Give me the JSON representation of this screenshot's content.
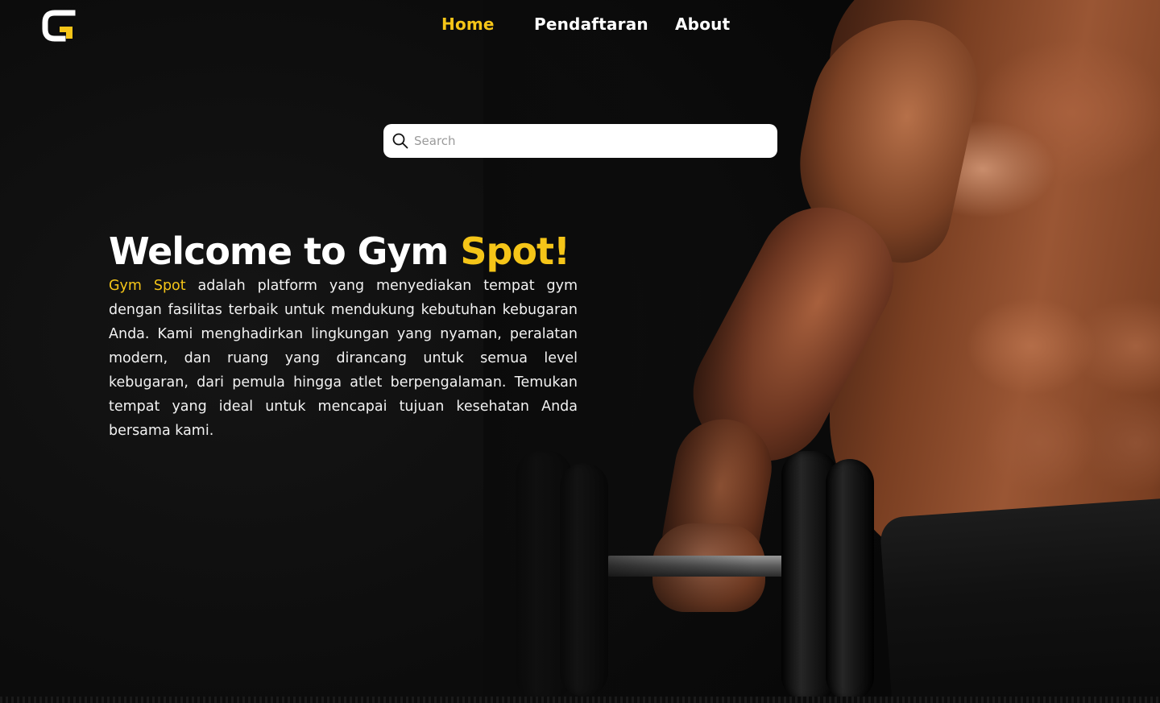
{
  "brand": {
    "logo_icon": "gym-spot-g-logo",
    "logo_colors": {
      "primary": "#ffffff",
      "accent": "#f5c518"
    }
  },
  "nav": {
    "items": [
      {
        "label": "Home",
        "active": true
      },
      {
        "label": "Pendaftaran",
        "active": false
      },
      {
        "label": "About",
        "active": false
      }
    ]
  },
  "search": {
    "icon": "search-icon",
    "placeholder": "Search",
    "value": ""
  },
  "hero": {
    "title_prefix": "Welcome to Gym ",
    "title_accent": "Spot!",
    "description_accent": "Gym Spot",
    "description_rest": " adalah platform yang menyediakan tempat gym dengan fasilitas terbaik untuk mendukung kebutuhan kebugaran Anda. Kami menghadirkan lingkungan yang nyaman, peralatan modern, dan ruang yang dirancang untuk semua level kebugaran, dari pemula hingga atlet berpengalaman. Temukan tempat yang ideal untuk mencapai tujuan kesehatan Anda bersama kami."
  },
  "theme": {
    "accent": "#f5c518",
    "background": "#0b0b0b",
    "text": "#ffffff"
  }
}
